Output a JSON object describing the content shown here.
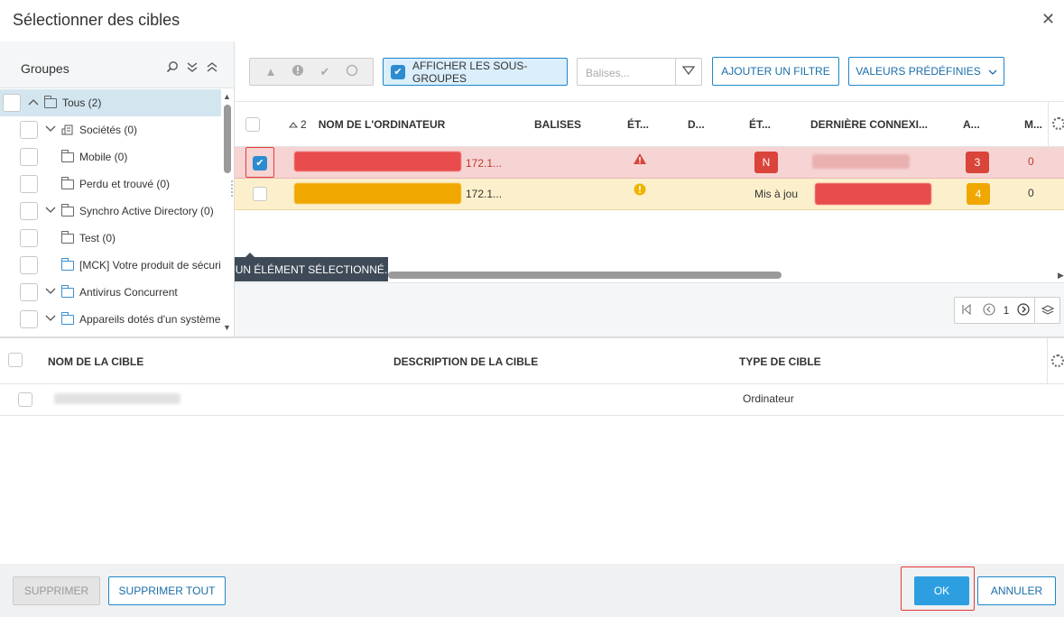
{
  "dialog": {
    "title": "Sélectionner des cibles",
    "close_glyph": "✕"
  },
  "groups": {
    "label": "Groupes",
    "items": [
      {
        "label": "Tous (2)"
      },
      {
        "label": "Sociétés (0)"
      },
      {
        "label": "Mobile (0)"
      },
      {
        "label": "Perdu et trouvé (0)"
      },
      {
        "label": "Synchro Active Directory (0)"
      },
      {
        "label": "Test (0)"
      },
      {
        "label": "[MCK] Votre produit de sécuri"
      },
      {
        "label": "Antivirus Concurrent"
      },
      {
        "label": "Appareils dotés d'un système"
      }
    ]
  },
  "toolbar": {
    "show_subgroups": "AFFICHER LES SOUS-GROUPES",
    "tags_placeholder": "Balises...",
    "add_filter": "AJOUTER UN FILTRE",
    "presets": "VALEURS PRÉDÉFINIES"
  },
  "computers_table": {
    "sort_indicator": "2",
    "columns": [
      "NOM DE L'ORDINATEUR",
      "BALISES",
      "ÉT...",
      "D...",
      "ÉT...",
      "DERNIÈRE CONNEXI...",
      "A...",
      "M..."
    ],
    "rows": [
      {
        "ip": "172.1...",
        "status2": "N",
        "alerts": "3",
        "m": "0"
      },
      {
        "ip": "172.1...",
        "status2_text": "Mis à jou",
        "alerts": "4",
        "m": "0"
      }
    ],
    "selection_tooltip": "UN ÉLÉMENT SÉLECTIONNÉ.",
    "page": "1"
  },
  "targets_table": {
    "columns": [
      "NOM DE LA CIBLE",
      "DESCRIPTION DE LA CIBLE",
      "TYPE DE CIBLE"
    ],
    "rows": [
      {
        "type": "Ordinateur"
      }
    ]
  },
  "footer": {
    "delete": "SUPPRIMER",
    "delete_all": "SUPPRIMER TOUT",
    "ok": "OK",
    "cancel": "ANNULER"
  },
  "colors": {
    "accent": "#2d9fe0",
    "danger_row": "#f6d4d4",
    "warning_row": "#fcf0cc",
    "danger_badge": "#d9443b",
    "warning_badge": "#f0a800"
  }
}
